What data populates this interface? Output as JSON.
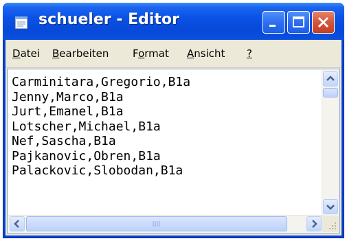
{
  "window": {
    "title": "schueler - Editor",
    "icon": "notepad-icon",
    "buttons": [
      "minimize-icon",
      "maximize-icon",
      "close-icon"
    ]
  },
  "menu": {
    "items": [
      {
        "label": "Datei",
        "accel": "D",
        "rest": "atei"
      },
      {
        "label": "Bearbeiten",
        "accel": "B",
        "rest": "earbeiten"
      },
      {
        "label": "Format",
        "pre": "F",
        "accel": "o",
        "rest": "rmat"
      },
      {
        "label": "Ansicht",
        "accel": "A",
        "rest": "nsicht"
      },
      {
        "label": "?",
        "accel": "?",
        "rest": ""
      }
    ]
  },
  "editor": {
    "lines": [
      "Carminitara,Gregorio,B1a",
      "Jenny,Marco,B1a",
      "Jurt,Emanel,B1a",
      "Lotscher,Michael,B1a",
      "Nef,Sascha,B1a",
      "Pajkanovic,Obren,B1a",
      "Palackovic,Slobodan,B1a"
    ]
  },
  "colors": {
    "titlebar": "#0a52e6",
    "close_button": "#d4553a",
    "client_bg": "#ece9d8",
    "editor_bg": "#ffffff"
  }
}
